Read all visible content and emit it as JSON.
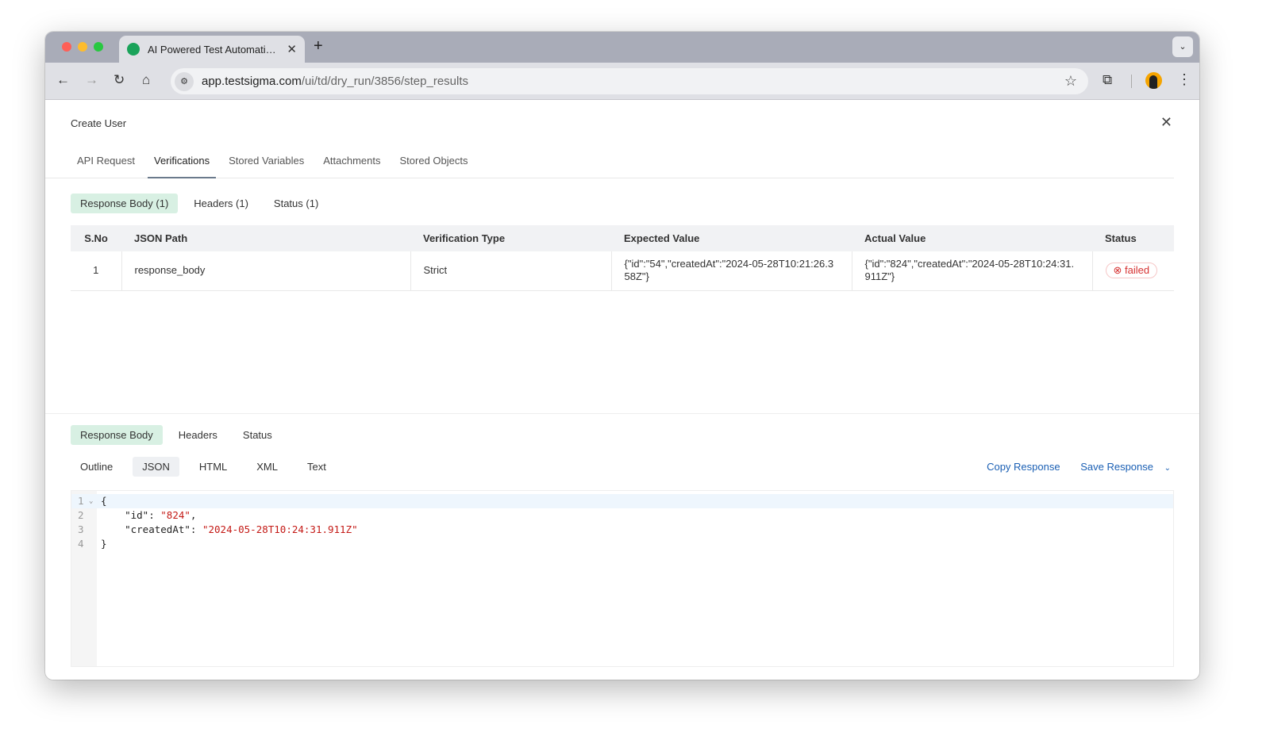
{
  "browser": {
    "tab_title": "AI Powered Test Automation Platform",
    "url_host": "app.testsigma.com",
    "url_path": "/ui/td/dry_run/3856/step_results",
    "icons": [
      "back-icon",
      "forward-icon",
      "reload-icon",
      "home-icon",
      "star-icon",
      "extensions-icon",
      "more-icon"
    ]
  },
  "panel": {
    "title": "Create User",
    "tabs": [
      "API Request",
      "Verifications",
      "Stored Variables",
      "Attachments",
      "Stored Objects"
    ],
    "verification_tabs": [
      "Response Body (1)",
      "Headers (1)",
      "Status (1)"
    ],
    "table": {
      "headers": [
        "S.No",
        "JSON Path",
        "Verification Type",
        "Expected Value",
        "Actual Value",
        "Status"
      ],
      "rows": [
        {
          "sno": "1",
          "path": "response_body",
          "type": "Strict",
          "expected": "{\"id\":\"54\",\"createdAt\":\"2024-05-28T10:21:26.358Z\"}",
          "actual": "{\"id\":\"824\",\"createdAt\":\"2024-05-28T10:24:31.911Z\"}",
          "status": "failed"
        }
      ]
    },
    "response_tabs": [
      "Response Body",
      "Headers",
      "Status"
    ],
    "format_tabs": [
      "Outline",
      "JSON",
      "HTML",
      "XML",
      "Text"
    ],
    "copy_response": "Copy Response",
    "save_response": "Save Response",
    "code": {
      "open": "{",
      "id_key": "\"id\"",
      "id_val": "\"824\"",
      "created_key": "\"createdAt\"",
      "created_val": "\"2024-05-28T10:24:31.911Z\"",
      "close": "}",
      "line_numbers": [
        "1",
        "2",
        "3",
        "4"
      ]
    }
  },
  "colors": {
    "accent_green": "#d8f0e3",
    "link": "#1a5fb4",
    "failed": "#d63232"
  }
}
